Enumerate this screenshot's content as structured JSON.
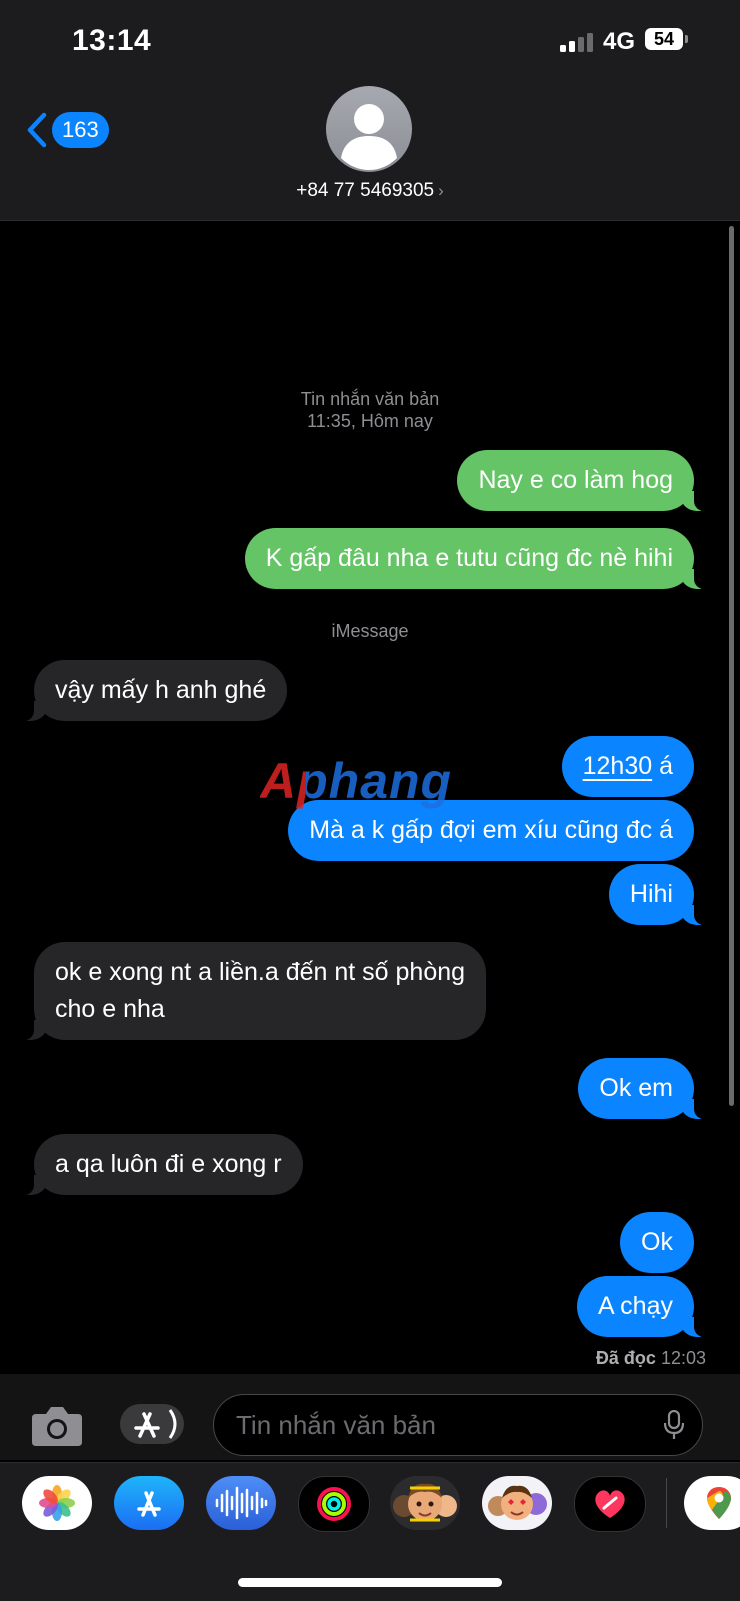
{
  "status_bar": {
    "time": "13:14",
    "network": "4G",
    "battery": "54"
  },
  "header": {
    "back_count": "163",
    "contact": "+84 77 5469305"
  },
  "thread": {
    "sms_header": {
      "type": "Tin nhắn văn bản",
      "time": "11:35, Hôm nay"
    },
    "imessage_label": "iMessage",
    "messages": [
      {
        "text": "Nay e co làm hog"
      },
      {
        "text": "K gấp đâu nha e tutu cũng đc nè hihi"
      },
      {
        "text": "vậy mấy h anh ghé"
      },
      {
        "link": "12h30",
        "text": " á"
      },
      {
        "text": "Mà a k gấp đợi em xíu cũng đc á"
      },
      {
        "text": "Hihi"
      },
      {
        "line1": "ok e xong nt a liền.a đến nt số phòng",
        "line2": "cho e nha"
      },
      {
        "text": "Ok em"
      },
      {
        "text": "a qa luôn đi e xong r"
      },
      {
        "text": "Ok"
      },
      {
        "text": "A chạy"
      }
    ],
    "read_receipt": {
      "label": "Đã đọc",
      "time": "12:03"
    }
  },
  "watermark": "Aphang",
  "input": {
    "placeholder": "Tin nhắn văn bản"
  },
  "apps": [
    "photos-icon",
    "app-store-icon",
    "audio-message-icon",
    "activity-icon",
    "memoji-icon",
    "animoji-icon",
    "digital-touch-icon",
    "google-maps-icon"
  ],
  "colors": {
    "sms_bubble": "#65c466",
    "imessage_bubble": "#0a84ff",
    "incoming_bubble": "#262629"
  }
}
